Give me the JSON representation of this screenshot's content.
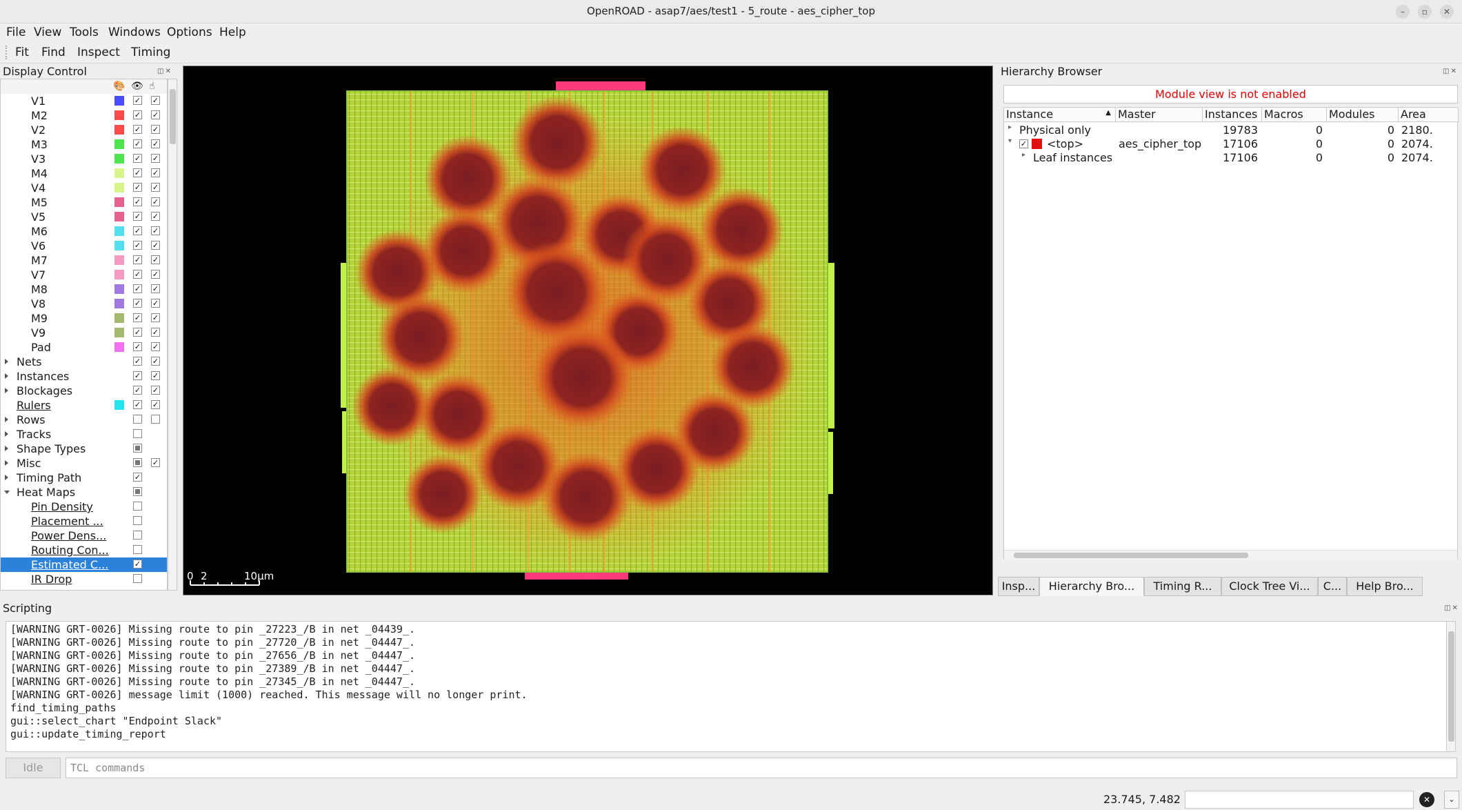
{
  "window": {
    "title": "OpenROAD - asap7/aes/test1 - 5_route - aes_cipher_top"
  },
  "menu": [
    "File",
    "View",
    "Tools",
    "Windows",
    "Options",
    "Help"
  ],
  "toolbar": [
    "Fit",
    "Find",
    "Inspect",
    "Timing"
  ],
  "display_control": {
    "title": "Display Control",
    "layers": [
      {
        "name": "V1",
        "color": "#4a4aff"
      },
      {
        "name": "M2",
        "color": "#ff4a4a"
      },
      {
        "name": "V2",
        "color": "#ff4a4a"
      },
      {
        "name": "M3",
        "color": "#4ee44e"
      },
      {
        "name": "V3",
        "color": "#4ee44e"
      },
      {
        "name": "M4",
        "color": "#d8f58c"
      },
      {
        "name": "V4",
        "color": "#d8f58c"
      },
      {
        "name": "M5",
        "color": "#e8608c"
      },
      {
        "name": "V5",
        "color": "#e8608c"
      },
      {
        "name": "M6",
        "color": "#52e0ee"
      },
      {
        "name": "V6",
        "color": "#52e0ee"
      },
      {
        "name": "M7",
        "color": "#f59ac0"
      },
      {
        "name": "V7",
        "color": "#f59ac0"
      },
      {
        "name": "M8",
        "color": "#a07ae0"
      },
      {
        "name": "V8",
        "color": "#a07ae0"
      },
      {
        "name": "M9",
        "color": "#a4b870"
      },
      {
        "name": "V9",
        "color": "#a4b870"
      },
      {
        "name": "Pad",
        "color": "#f070f0"
      }
    ],
    "groups": [
      {
        "name": "Nets",
        "visible": true,
        "selectable": true
      },
      {
        "name": "Instances",
        "visible": true,
        "selectable": true
      },
      {
        "name": "Blockages",
        "visible": true,
        "selectable": true
      },
      {
        "name": "Rulers",
        "visible": true,
        "selectable": true,
        "color": "#22e5f0"
      },
      {
        "name": "Rows",
        "visible": false,
        "selectable": false
      },
      {
        "name": "Tracks",
        "visible": false
      },
      {
        "name": "Shape Types",
        "visible": "partial"
      },
      {
        "name": "Misc",
        "visible": "partial",
        "selectable": true
      },
      {
        "name": "Timing Path",
        "visible": true
      },
      {
        "name": "Heat Maps",
        "visible": "partial"
      }
    ],
    "heatmaps": [
      {
        "name": "Pin Density",
        "checked": false
      },
      {
        "name": "Placement ...",
        "checked": false
      },
      {
        "name": "Power Dens...",
        "checked": false
      },
      {
        "name": "Routing Con...",
        "checked": false
      },
      {
        "name": "Estimated C...",
        "checked": true,
        "selected": true
      },
      {
        "name": "IR Drop",
        "checked": false
      }
    ]
  },
  "layout": {
    "scale_zero": "0",
    "scale_two": "2",
    "scale_label": "10μm"
  },
  "hierarchy": {
    "title": "Hierarchy Browser",
    "module_view_msg": "Module view is not enabled",
    "columns": [
      "Instance",
      "Master",
      "Instances",
      "Macros",
      "Modules",
      "Area"
    ],
    "rows": [
      {
        "instance": "Physical only",
        "master": "",
        "instances": "19783",
        "macros": "0",
        "modules": "0",
        "area": "2180."
      },
      {
        "instance": "<top>",
        "master": "aes_cipher_top",
        "instances": "17106",
        "macros": "0",
        "modules": "0",
        "area": "2074."
      },
      {
        "instance": "Leaf instances",
        "master": "",
        "instances": "17106",
        "macros": "0",
        "modules": "0",
        "area": "2074."
      }
    ]
  },
  "tabs": [
    "Insp...",
    "Hierarchy Bro...",
    "Timing R...",
    "Clock Tree Vi...",
    "C...",
    "Help Bro..."
  ],
  "scripting": {
    "title": "Scripting",
    "log": [
      "[WARNING GRT-0026] Missing route to pin _27223_/B in net _04439_.",
      "[WARNING GRT-0026] Missing route to pin _27720_/B in net _04447_.",
      "[WARNING GRT-0026] Missing route to pin _27656_/B in net _04447_.",
      "[WARNING GRT-0026] Missing route to pin _27389_/B in net _04447_.",
      "[WARNING GRT-0026] Missing route to pin _27345_/B in net _04447_.",
      "[WARNING GRT-0026] message limit (1000) reached. This message will no longer print.",
      "find_timing_paths",
      "gui::select_chart \"Endpoint Slack\"",
      "gui::update_timing_report"
    ],
    "idle_label": "Idle",
    "input_placeholder": "TCL commands"
  },
  "status": {
    "coords": "23.745, 7.482"
  }
}
